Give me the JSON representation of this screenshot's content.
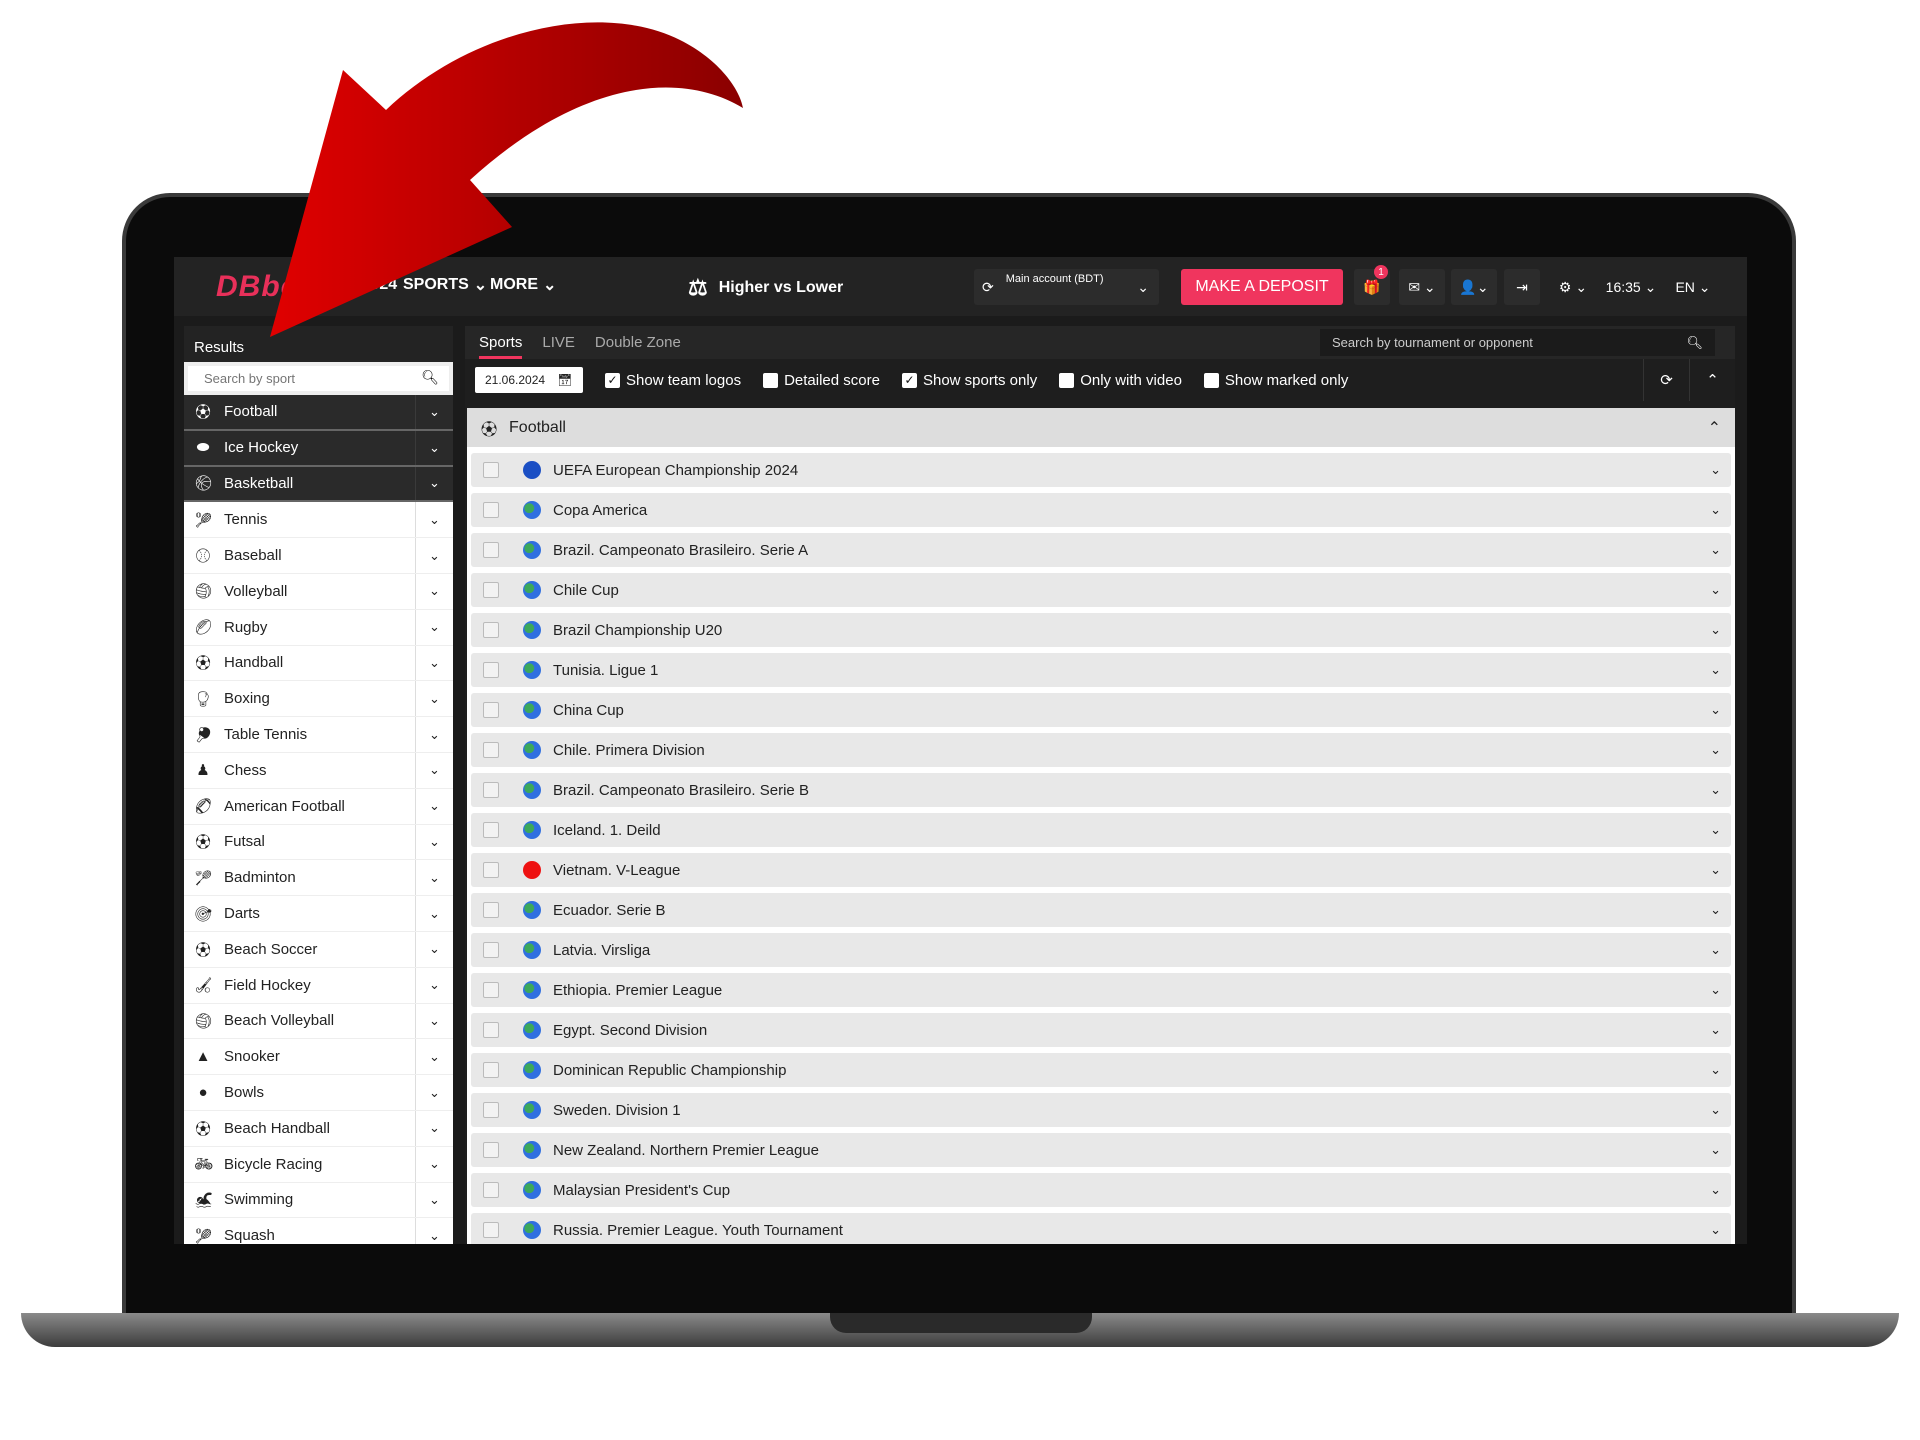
{
  "colors": {
    "accent": "#f0355e",
    "arrow": "#d10000"
  },
  "header": {
    "logo": "DBbet",
    "nav": [
      {
        "label": "EU 2024",
        "icon": "trophy-icon"
      },
      {
        "label": "SPORTS"
      },
      {
        "label": "MORE"
      },
      {
        "label": "Higher vs Lower",
        "icon": "scales-icon"
      }
    ],
    "account_label": "Main account (BDT)",
    "deposit": "MAKE A DEPOSIT",
    "gift_badge": "1",
    "time": "16:35",
    "lang": "EN"
  },
  "sidebar": {
    "title": "Results",
    "search_placeholder": "Search by sport",
    "items": [
      "Football",
      "Ice Hockey",
      "Basketball",
      "Tennis",
      "Baseball",
      "Volleyball",
      "Rugby",
      "Handball",
      "Boxing",
      "Table Tennis",
      "Chess",
      "American Football",
      "Futsal",
      "Badminton",
      "Darts",
      "Beach Soccer",
      "Field Hockey",
      "Beach Volleyball",
      "Snooker",
      "Bowls",
      "Beach Handball",
      "Bicycle Racing",
      "Swimming",
      "Squash"
    ]
  },
  "main": {
    "tabs": [
      "Sports",
      "LIVE",
      "Double Zone"
    ],
    "search_placeholder": "Search by tournament or opponent",
    "date": "21.06.2024",
    "filters": [
      {
        "label": "Show team logos",
        "checked": true
      },
      {
        "label": "Detailed score",
        "checked": false
      },
      {
        "label": "Show sports only",
        "checked": true
      },
      {
        "label": "Only with video",
        "checked": false
      },
      {
        "label": "Show marked only",
        "checked": false
      }
    ],
    "section": "Football",
    "leagues": [
      "UEFA European Championship 2024",
      "Copa America",
      "Brazil. Campeonato Brasileiro. Serie A",
      "Chile Cup",
      "Brazil Championship U20",
      "Tunisia. Ligue 1",
      "China Cup",
      "Chile. Primera Division",
      "Brazil. Campeonato Brasileiro. Serie B",
      "Iceland. 1. Deild",
      "Vietnam. V-League",
      "Ecuador. Serie B",
      "Latvia. Virsliga",
      "Ethiopia. Premier League",
      "Egypt. Second Division",
      "Dominican Republic Championship",
      "Sweden. Division 1",
      "New Zealand. Northern Premier League",
      "Malaysian President's Cup",
      "Russia. Premier League. Youth Tournament"
    ]
  }
}
